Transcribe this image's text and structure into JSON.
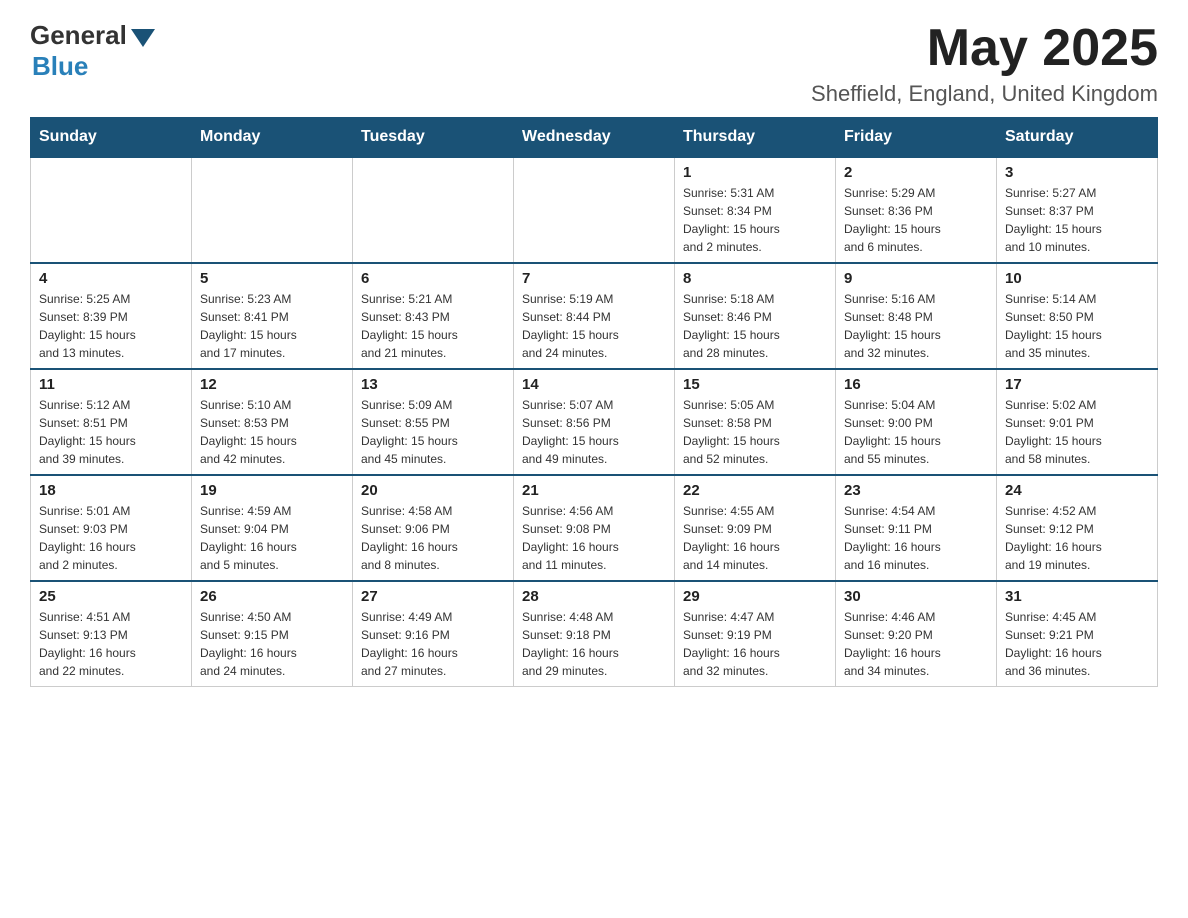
{
  "header": {
    "logo_general": "General",
    "logo_blue": "Blue",
    "month_title": "May 2025",
    "location": "Sheffield, England, United Kingdom"
  },
  "days_of_week": [
    "Sunday",
    "Monday",
    "Tuesday",
    "Wednesday",
    "Thursday",
    "Friday",
    "Saturday"
  ],
  "weeks": [
    {
      "days": [
        {
          "num": "",
          "info": ""
        },
        {
          "num": "",
          "info": ""
        },
        {
          "num": "",
          "info": ""
        },
        {
          "num": "",
          "info": ""
        },
        {
          "num": "1",
          "info": "Sunrise: 5:31 AM\nSunset: 8:34 PM\nDaylight: 15 hours\nand 2 minutes."
        },
        {
          "num": "2",
          "info": "Sunrise: 5:29 AM\nSunset: 8:36 PM\nDaylight: 15 hours\nand 6 minutes."
        },
        {
          "num": "3",
          "info": "Sunrise: 5:27 AM\nSunset: 8:37 PM\nDaylight: 15 hours\nand 10 minutes."
        }
      ]
    },
    {
      "days": [
        {
          "num": "4",
          "info": "Sunrise: 5:25 AM\nSunset: 8:39 PM\nDaylight: 15 hours\nand 13 minutes."
        },
        {
          "num": "5",
          "info": "Sunrise: 5:23 AM\nSunset: 8:41 PM\nDaylight: 15 hours\nand 17 minutes."
        },
        {
          "num": "6",
          "info": "Sunrise: 5:21 AM\nSunset: 8:43 PM\nDaylight: 15 hours\nand 21 minutes."
        },
        {
          "num": "7",
          "info": "Sunrise: 5:19 AM\nSunset: 8:44 PM\nDaylight: 15 hours\nand 24 minutes."
        },
        {
          "num": "8",
          "info": "Sunrise: 5:18 AM\nSunset: 8:46 PM\nDaylight: 15 hours\nand 28 minutes."
        },
        {
          "num": "9",
          "info": "Sunrise: 5:16 AM\nSunset: 8:48 PM\nDaylight: 15 hours\nand 32 minutes."
        },
        {
          "num": "10",
          "info": "Sunrise: 5:14 AM\nSunset: 8:50 PM\nDaylight: 15 hours\nand 35 minutes."
        }
      ]
    },
    {
      "days": [
        {
          "num": "11",
          "info": "Sunrise: 5:12 AM\nSunset: 8:51 PM\nDaylight: 15 hours\nand 39 minutes."
        },
        {
          "num": "12",
          "info": "Sunrise: 5:10 AM\nSunset: 8:53 PM\nDaylight: 15 hours\nand 42 minutes."
        },
        {
          "num": "13",
          "info": "Sunrise: 5:09 AM\nSunset: 8:55 PM\nDaylight: 15 hours\nand 45 minutes."
        },
        {
          "num": "14",
          "info": "Sunrise: 5:07 AM\nSunset: 8:56 PM\nDaylight: 15 hours\nand 49 minutes."
        },
        {
          "num": "15",
          "info": "Sunrise: 5:05 AM\nSunset: 8:58 PM\nDaylight: 15 hours\nand 52 minutes."
        },
        {
          "num": "16",
          "info": "Sunrise: 5:04 AM\nSunset: 9:00 PM\nDaylight: 15 hours\nand 55 minutes."
        },
        {
          "num": "17",
          "info": "Sunrise: 5:02 AM\nSunset: 9:01 PM\nDaylight: 15 hours\nand 58 minutes."
        }
      ]
    },
    {
      "days": [
        {
          "num": "18",
          "info": "Sunrise: 5:01 AM\nSunset: 9:03 PM\nDaylight: 16 hours\nand 2 minutes."
        },
        {
          "num": "19",
          "info": "Sunrise: 4:59 AM\nSunset: 9:04 PM\nDaylight: 16 hours\nand 5 minutes."
        },
        {
          "num": "20",
          "info": "Sunrise: 4:58 AM\nSunset: 9:06 PM\nDaylight: 16 hours\nand 8 minutes."
        },
        {
          "num": "21",
          "info": "Sunrise: 4:56 AM\nSunset: 9:08 PM\nDaylight: 16 hours\nand 11 minutes."
        },
        {
          "num": "22",
          "info": "Sunrise: 4:55 AM\nSunset: 9:09 PM\nDaylight: 16 hours\nand 14 minutes."
        },
        {
          "num": "23",
          "info": "Sunrise: 4:54 AM\nSunset: 9:11 PM\nDaylight: 16 hours\nand 16 minutes."
        },
        {
          "num": "24",
          "info": "Sunrise: 4:52 AM\nSunset: 9:12 PM\nDaylight: 16 hours\nand 19 minutes."
        }
      ]
    },
    {
      "days": [
        {
          "num": "25",
          "info": "Sunrise: 4:51 AM\nSunset: 9:13 PM\nDaylight: 16 hours\nand 22 minutes."
        },
        {
          "num": "26",
          "info": "Sunrise: 4:50 AM\nSunset: 9:15 PM\nDaylight: 16 hours\nand 24 minutes."
        },
        {
          "num": "27",
          "info": "Sunrise: 4:49 AM\nSunset: 9:16 PM\nDaylight: 16 hours\nand 27 minutes."
        },
        {
          "num": "28",
          "info": "Sunrise: 4:48 AM\nSunset: 9:18 PM\nDaylight: 16 hours\nand 29 minutes."
        },
        {
          "num": "29",
          "info": "Sunrise: 4:47 AM\nSunset: 9:19 PM\nDaylight: 16 hours\nand 32 minutes."
        },
        {
          "num": "30",
          "info": "Sunrise: 4:46 AM\nSunset: 9:20 PM\nDaylight: 16 hours\nand 34 minutes."
        },
        {
          "num": "31",
          "info": "Sunrise: 4:45 AM\nSunset: 9:21 PM\nDaylight: 16 hours\nand 36 minutes."
        }
      ]
    }
  ]
}
